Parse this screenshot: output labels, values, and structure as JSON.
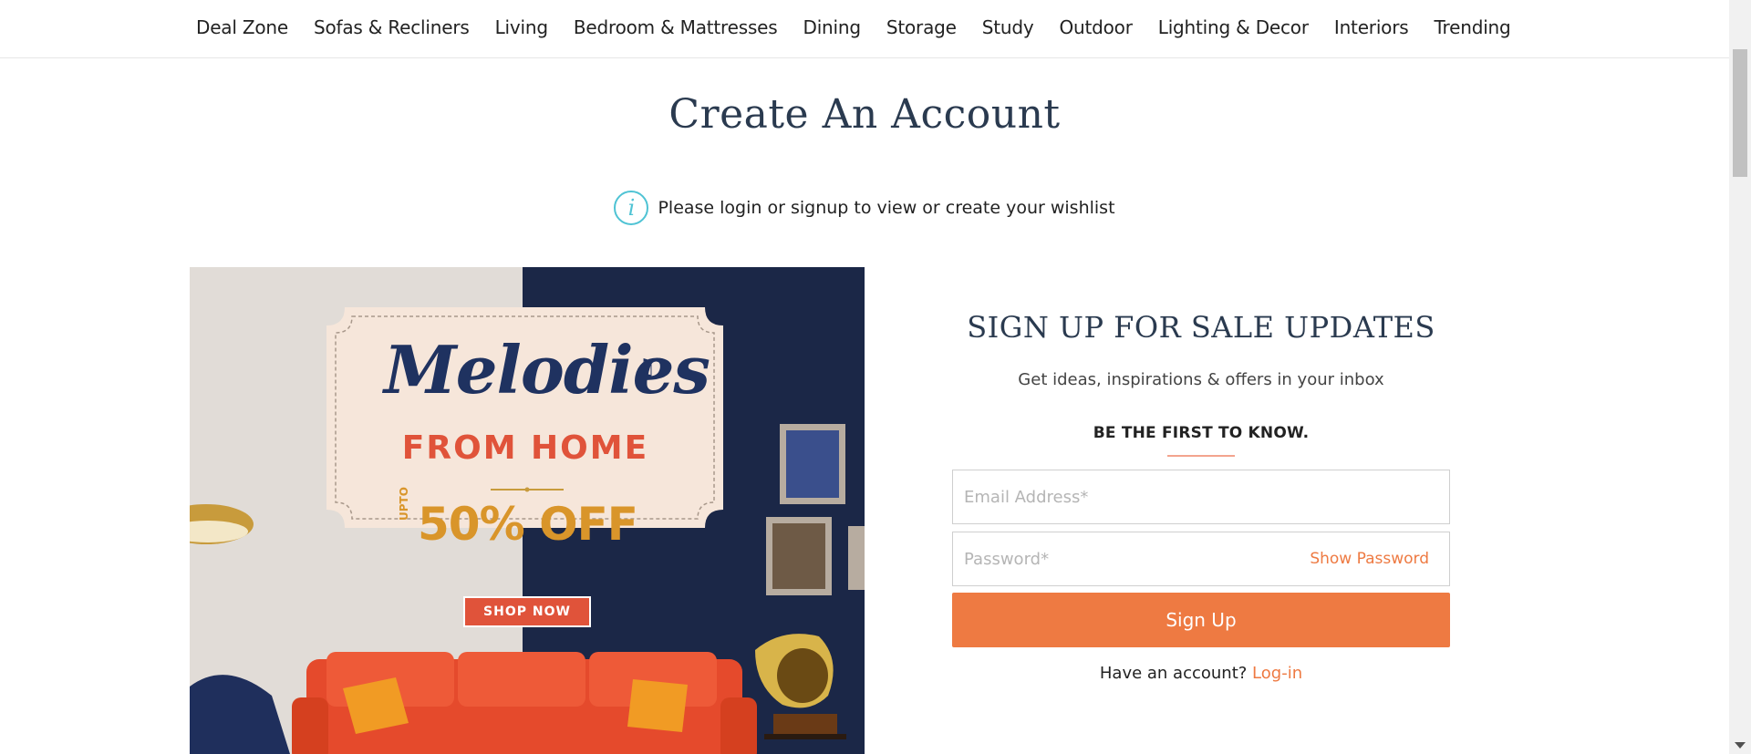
{
  "nav": {
    "items": [
      "Deal Zone",
      "Sofas & Recliners",
      "Living",
      "Bedroom & Mattresses",
      "Dining",
      "Storage",
      "Study",
      "Outdoor",
      "Lighting & Decor",
      "Interiors",
      "Trending"
    ]
  },
  "page": {
    "title": "Create An Account",
    "info_icon": "info-icon",
    "info_text": "Please login or signup to view or create your wishlist"
  },
  "banner": {
    "script_title": "Melodies",
    "subtitle": "FROM HOME",
    "upto": "UPTO",
    "offer": "50% OFF",
    "cta": "SHOP NOW"
  },
  "form": {
    "title": "SIGN UP FOR SALE UPDATES",
    "subtitle": "Get ideas, inspirations & offers in your inbox",
    "kicker": "BE THE FIRST TO KNOW.",
    "email_placeholder": "Email Address*",
    "password_placeholder": "Password*",
    "show_password": "Show Password",
    "submit": "Sign Up",
    "have_account": "Have an account?",
    "login_link": "Log-in"
  },
  "colors": {
    "accent": "#ee7a42",
    "heading": "#2a3a4f",
    "info": "#4fc3d4",
    "banner_navy": "#1b2747",
    "sofa": "#e54a2c"
  }
}
